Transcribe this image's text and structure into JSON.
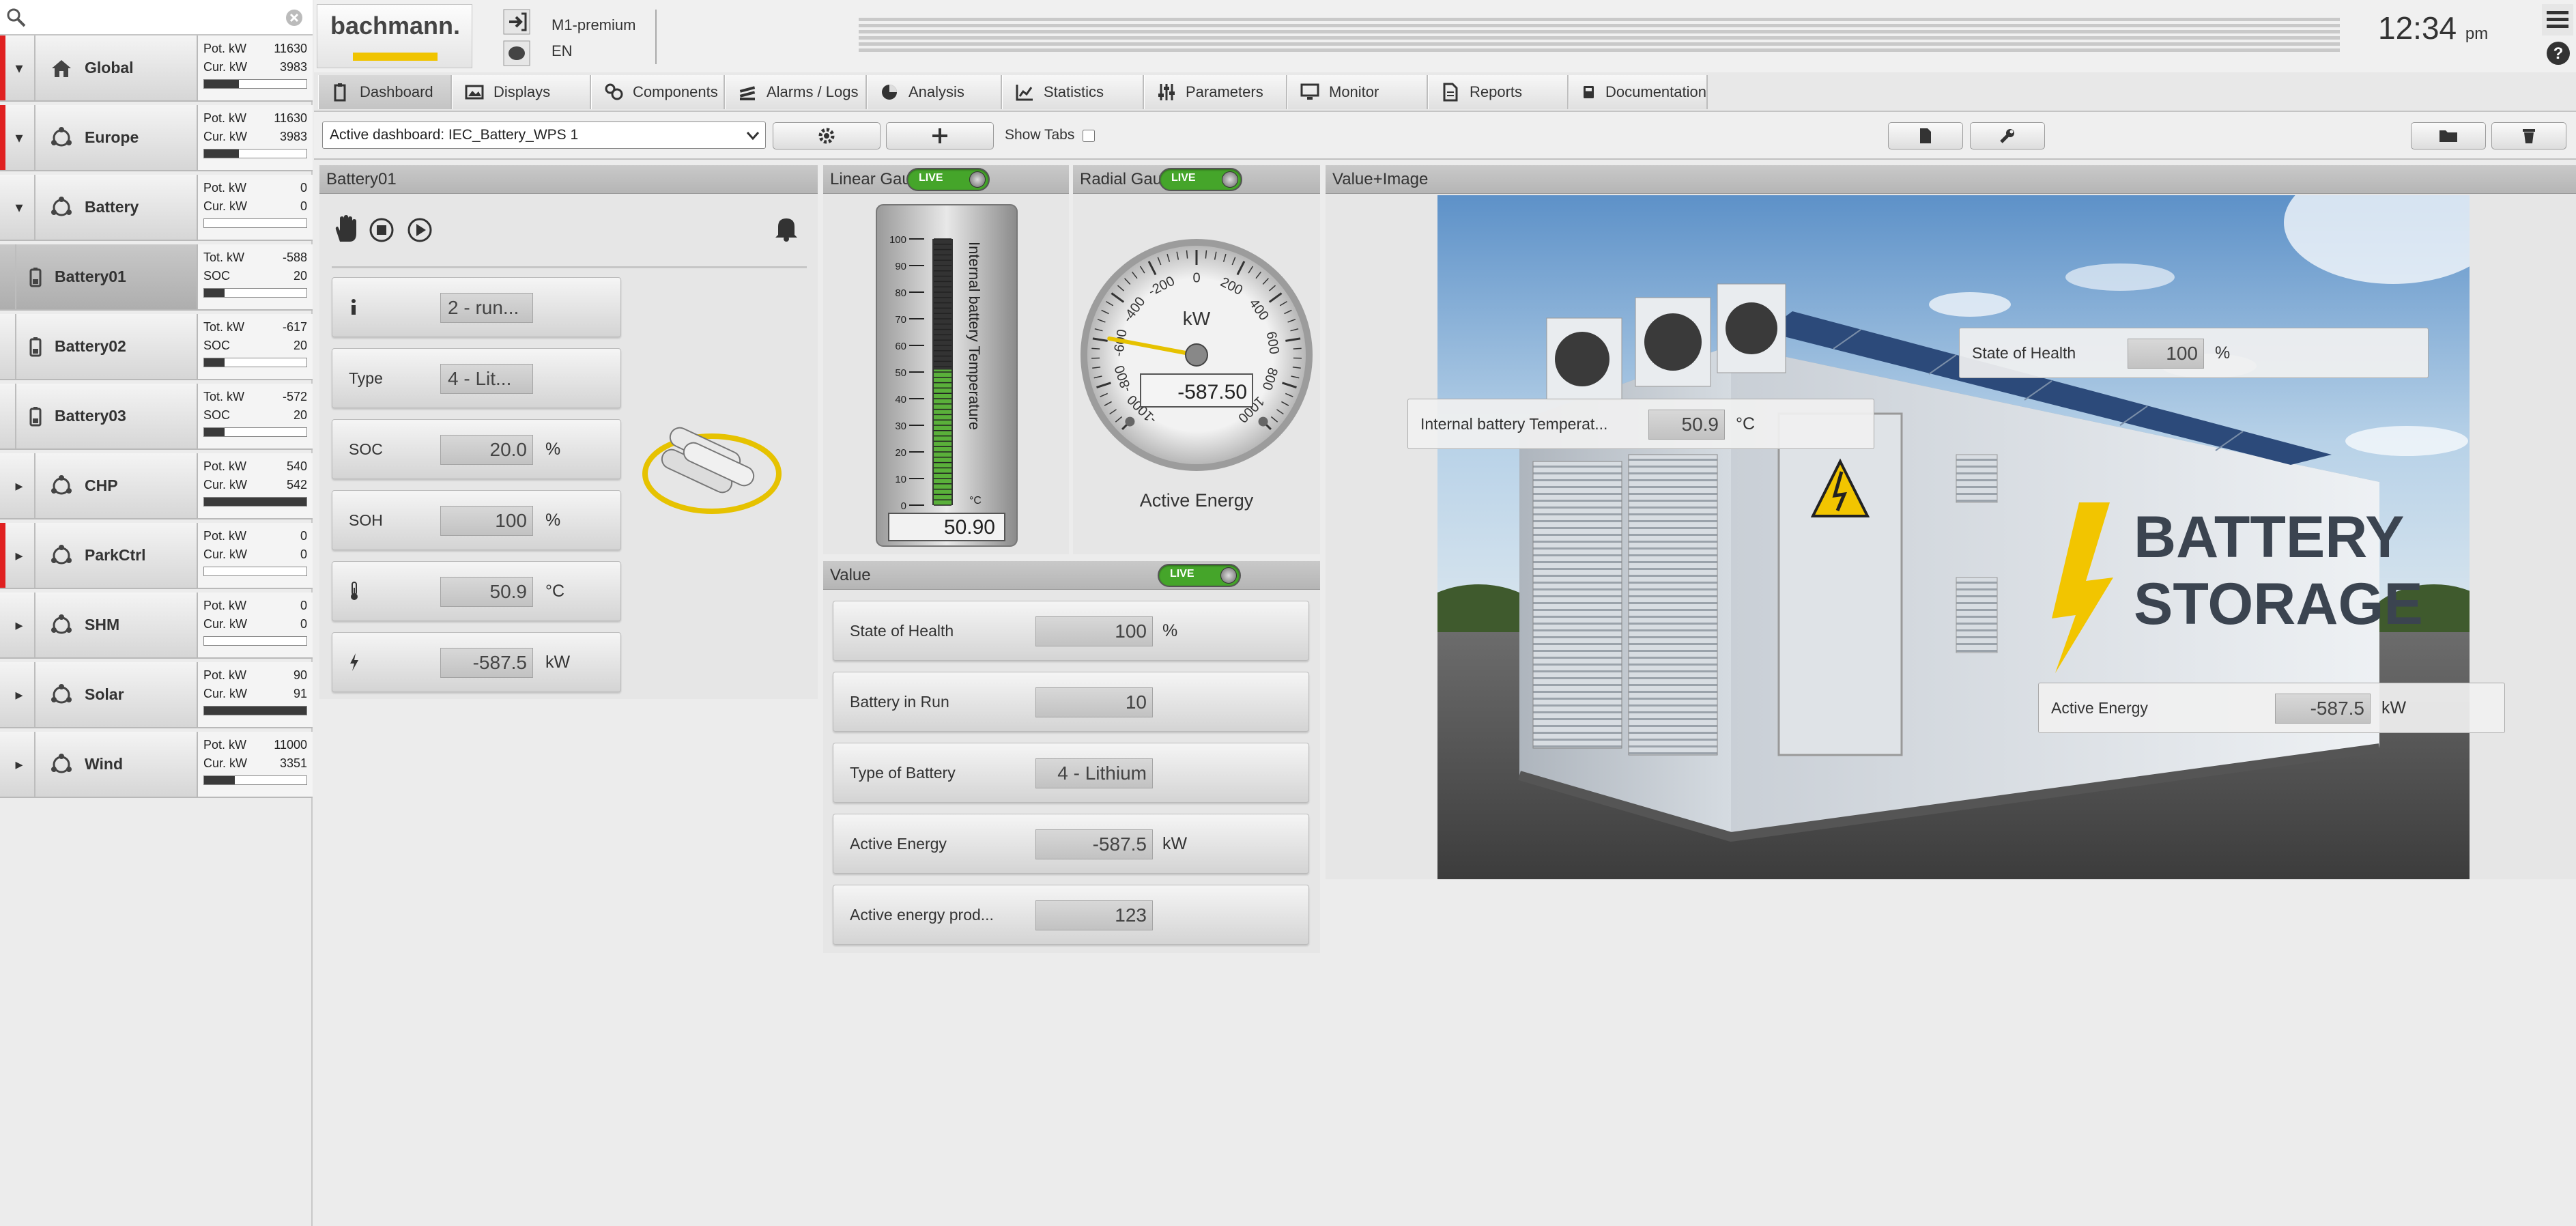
{
  "sidebar": {
    "nodes": [
      {
        "label": "Global",
        "toggle": "▾",
        "icon": "house-icon",
        "pot": "11630",
        "cur": "3983",
        "bar": 0.34,
        "marker": true
      },
      {
        "label": "Europe",
        "toggle": "▾",
        "icon": "cluster-icon",
        "pot": "11630",
        "cur": "3983",
        "bar": 0.34,
        "marker": true
      },
      {
        "label": "Battery",
        "toggle": "▾",
        "icon": "cluster-icon",
        "pot": "0",
        "cur": "0",
        "bar": 0.0,
        "marker": false
      },
      {
        "label": "Battery01",
        "toggle": "",
        "icon": "battery-icon",
        "pot": "-588",
        "cur": "20",
        "bar": 0.2,
        "marker": false,
        "selected": true
      },
      {
        "label": "Battery02",
        "toggle": "",
        "icon": "battery-icon",
        "pot": "-617",
        "cur": "20",
        "bar": 0.2,
        "marker": false
      },
      {
        "label": "Battery03",
        "toggle": "",
        "icon": "battery-icon",
        "pot": "-572",
        "cur": "20",
        "bar": 0.2,
        "marker": false
      },
      {
        "label": "CHP",
        "toggle": "▸",
        "icon": "cluster-icon",
        "pot": "540",
        "cur": "542",
        "bar": 1.0,
        "marker": false
      },
      {
        "label": "ParkCtrl",
        "toggle": "▸",
        "icon": "cluster-icon",
        "pot": "0",
        "cur": "0",
        "bar": 0.0,
        "marker": true
      },
      {
        "label": "SHM",
        "toggle": "▸",
        "icon": "cluster-icon",
        "pot": "0",
        "cur": "0",
        "bar": 0.0,
        "marker": false
      },
      {
        "label": "Solar",
        "toggle": "▸",
        "icon": "cluster-icon",
        "pot": "90",
        "cur": "91",
        "bar": 1.0,
        "marker": false
      },
      {
        "label": "Wind",
        "toggle": "▸",
        "icon": "cluster-icon",
        "pot": "11000",
        "cur": "3351",
        "bar": 0.3,
        "marker": false
      }
    ],
    "pot_label": "Pot. kW",
    "cur_label": "Cur. kW",
    "tot_label": "Tot. kW",
    "soc_label": "SOC"
  },
  "header": {
    "logo": "bachmann.",
    "user": "M1-premium",
    "language": "EN",
    "clock": "12:34",
    "clock_suffix": "pm"
  },
  "menu": {
    "tabs": [
      {
        "label": "Dashboard",
        "icon": "clipboard-icon"
      },
      {
        "label": "Displays",
        "icon": "display-icon"
      },
      {
        "label": "Components",
        "icon": "components-icon"
      },
      {
        "label": "Alarms / Logs",
        "icon": "alarms-icon"
      },
      {
        "label": "Analysis",
        "icon": "pie-icon"
      },
      {
        "label": "Statistics",
        "icon": "chart-icon"
      },
      {
        "label": "Parameters",
        "icon": "sliders-icon"
      },
      {
        "label": "Monitor",
        "icon": "monitor-icon"
      },
      {
        "label": "Reports",
        "icon": "report-icon"
      },
      {
        "label": "Documentation",
        "icon": "book-icon"
      }
    ]
  },
  "toolbar": {
    "dashboard_select": "Active dashboard: IEC_Battery_WPS 1",
    "show_tabs": "Show Tabs"
  },
  "battery_panel": {
    "title": "Battery01",
    "rows": [
      {
        "label": "",
        "icon": "info-icon",
        "value": "2 - run...",
        "unit": ""
      },
      {
        "label": "Type",
        "icon": "",
        "value": "4 - Lit...",
        "unit": ""
      },
      {
        "label": "SOC",
        "icon": "",
        "value": "20.0",
        "unit": "%"
      },
      {
        "label": "SOH",
        "icon": "",
        "value": "100",
        "unit": "%"
      },
      {
        "label": "",
        "icon": "thermometer-icon",
        "value": "50.9",
        "unit": "°C"
      },
      {
        "label": "",
        "icon": "lightning-icon",
        "value": "-587.5",
        "unit": "kW"
      }
    ]
  },
  "linear_gauge": {
    "title": "Linear Gau",
    "live": "LIVE",
    "label": "Internal battery Temperature",
    "unit": "°C",
    "value": "50.90",
    "level": 0.509,
    "ticks": [
      "100",
      "90",
      "80",
      "70",
      "60",
      "50",
      "40",
      "30",
      "20",
      "10",
      "0"
    ]
  },
  "radial_gauge": {
    "title": "Radial Gau",
    "live": "LIVE",
    "unit": "kW",
    "value": "-587.50",
    "caption": "Active Energy",
    "value_num": -587.5,
    "min": -1000,
    "max": 1000,
    "ticks": [
      "-1000",
      "-800",
      "-600",
      "-400",
      "-200",
      "0",
      "200",
      "400",
      "600",
      "800",
      "1000"
    ]
  },
  "value_panel": {
    "title": "Value",
    "live": "LIVE",
    "rows": [
      {
        "label": "State of Health",
        "value": "100",
        "unit": "%"
      },
      {
        "label": "Battery in Run",
        "value": "10",
        "unit": ""
      },
      {
        "label": "Type of Battery",
        "value": "4 - Lithium",
        "unit": ""
      },
      {
        "label": "Active Energy",
        "value": "-587.5",
        "unit": "kW"
      },
      {
        "label": "Active energy prod...",
        "value": "123",
        "unit": ""
      }
    ]
  },
  "image_panel": {
    "title": "Value+Image",
    "sign_line1": "BATTERY",
    "sign_line2": "STORAGE",
    "overlays": [
      {
        "label": "State of Health",
        "value": "100",
        "unit": "%"
      },
      {
        "label": "Internal battery Temperat...",
        "value": "50.9",
        "unit": "°C"
      },
      {
        "label": "Active Energy",
        "value": "-587.5",
        "unit": "kW"
      }
    ]
  }
}
